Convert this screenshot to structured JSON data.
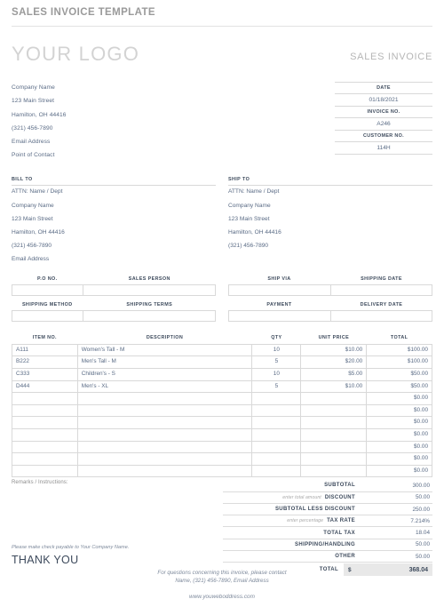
{
  "banner": {
    "title": "SALES INVOICE TEMPLATE"
  },
  "header": {
    "logo": "YOUR LOGO",
    "doc_type": "SALES INVOICE"
  },
  "company": {
    "lines": [
      "Company Name",
      "123 Main Street",
      "Hamilton, OH 44416",
      "(321) 456-7890",
      "Email Address",
      "Point of Contact"
    ]
  },
  "meta": [
    {
      "label": "DATE",
      "value": "01/18/2021"
    },
    {
      "label": "INVOICE NO.",
      "value": "A246"
    },
    {
      "label": "CUSTOMER NO.",
      "value": "114H"
    }
  ],
  "bill_to": {
    "heading": "BILL TO",
    "lines": [
      "ATTN: Name / Dept",
      "Company Name",
      "123 Main Street",
      "Hamilton, OH 44416",
      "(321) 456-7890",
      "Email Address"
    ]
  },
  "ship_to": {
    "heading": "SHIP TO",
    "lines": [
      "ATTN: Name / Dept",
      "Company Name",
      "123 Main Street",
      "Hamilton, OH 44416",
      "(321) 456-7890"
    ]
  },
  "shipping_fields": {
    "left": [
      {
        "label": "P.O NO.",
        "value": ""
      },
      {
        "label": "SALES PERSON",
        "value": ""
      },
      {
        "label": "SHIPPING METHOD",
        "value": ""
      },
      {
        "label": "SHIPPING TERMS",
        "value": ""
      }
    ],
    "right": [
      {
        "label": "SHIP VIA",
        "value": ""
      },
      {
        "label": "SHIPPING DATE",
        "value": ""
      },
      {
        "label": "PAYMENT",
        "value": ""
      },
      {
        "label": "DELIVERY DATE",
        "value": ""
      }
    ]
  },
  "items_table": {
    "columns": [
      "ITEM NO.",
      "DESCRIPTION",
      "QTY",
      "UNIT PRICE",
      "TOTAL"
    ],
    "rows": [
      {
        "item": "A111",
        "description": "Women's Tall - M",
        "qty": "10",
        "unit_price": "$10.00",
        "total": "$100.00"
      },
      {
        "item": "B222",
        "description": "Men's Tall - M",
        "qty": "5",
        "unit_price": "$20.00",
        "total": "$100.00"
      },
      {
        "item": "C333",
        "description": "Children's - S",
        "qty": "10",
        "unit_price": "$5.00",
        "total": "$50.00"
      },
      {
        "item": "D444",
        "description": "Men's - XL",
        "qty": "5",
        "unit_price": "$10.00",
        "total": "$50.00"
      },
      {
        "item": "",
        "description": "",
        "qty": "",
        "unit_price": "",
        "total": "$0.00"
      },
      {
        "item": "",
        "description": "",
        "qty": "",
        "unit_price": "",
        "total": "$0.00"
      },
      {
        "item": "",
        "description": "",
        "qty": "",
        "unit_price": "",
        "total": "$0.00"
      },
      {
        "item": "",
        "description": "",
        "qty": "",
        "unit_price": "",
        "total": "$0.00"
      },
      {
        "item": "",
        "description": "",
        "qty": "",
        "unit_price": "",
        "total": "$0.00"
      },
      {
        "item": "",
        "description": "",
        "qty": "",
        "unit_price": "",
        "total": "$0.00"
      },
      {
        "item": "",
        "description": "",
        "qty": "",
        "unit_price": "",
        "total": "$0.00"
      }
    ]
  },
  "remarks": {
    "label": "Remarks / Instructions:",
    "payable_note": "Please make check payable to Your Company Name.",
    "thank_you": "THANK YOU"
  },
  "totals": {
    "rows": [
      {
        "hint": "",
        "label": "SUBTOTAL",
        "value": "300.00"
      },
      {
        "hint": "enter total amount",
        "label": "DISCOUNT",
        "value": "50.00"
      },
      {
        "hint": "",
        "label": "SUBTOTAL LESS DISCOUNT",
        "value": "250.00"
      },
      {
        "hint": "enter percentage",
        "label": "TAX RATE",
        "value": "7.214%"
      },
      {
        "hint": "",
        "label": "TOTAL TAX",
        "value": "18.04"
      },
      {
        "hint": "",
        "label": "SHIPPING/HANDLING",
        "value": "50.00"
      },
      {
        "hint": "",
        "label": "OTHER",
        "value": "50.00"
      }
    ],
    "grand": {
      "label": "TOTAL",
      "currency": "$",
      "value": "368.04"
    }
  },
  "footer": {
    "line1": "For questions concerning this invoice, please contact",
    "line2": "Name, (321) 456-7890, Email Address",
    "url": "www.youweboddress.com"
  }
}
